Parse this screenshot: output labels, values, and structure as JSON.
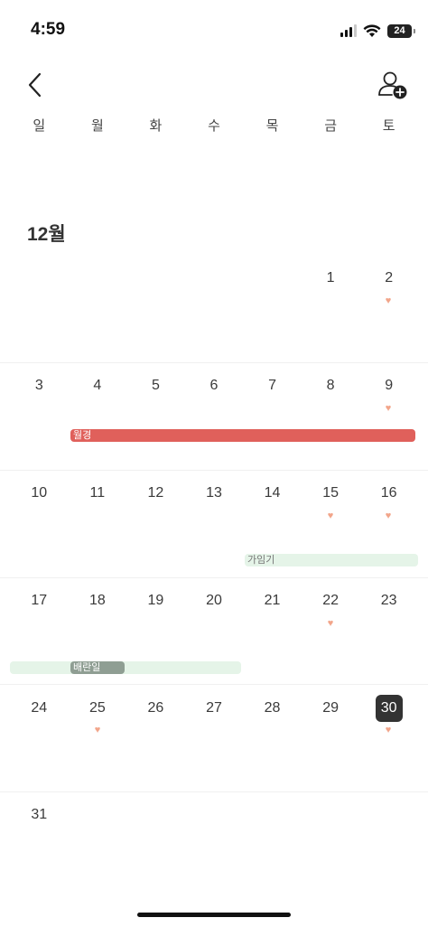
{
  "status": {
    "time": "4:59",
    "battery": "24"
  },
  "weekdays": [
    "일",
    "월",
    "화",
    "수",
    "목",
    "금",
    "토"
  ],
  "month": "12월",
  "weeks": [
    {
      "days": [
        "",
        "",
        "",
        "",
        "",
        "1",
        "2"
      ]
    },
    {
      "days": [
        "3",
        "4",
        "5",
        "6",
        "7",
        "8",
        "9"
      ]
    },
    {
      "days": [
        "10",
        "11",
        "12",
        "13",
        "14",
        "15",
        "16"
      ]
    },
    {
      "days": [
        "17",
        "18",
        "19",
        "20",
        "21",
        "22",
        "23"
      ]
    },
    {
      "days": [
        "24",
        "25",
        "26",
        "27",
        "28",
        "29",
        "30"
      ]
    },
    {
      "days": [
        "31",
        "",
        "",
        "",
        "",
        "",
        ""
      ]
    }
  ],
  "today": "30",
  "events": {
    "period": "월경",
    "fertile": "가임기",
    "ovulation": "배란일"
  },
  "colors": {
    "period": "#e0605b",
    "fertile": "#e5f4e8",
    "heart": "#f2a58a",
    "today_bg": "#333333"
  }
}
